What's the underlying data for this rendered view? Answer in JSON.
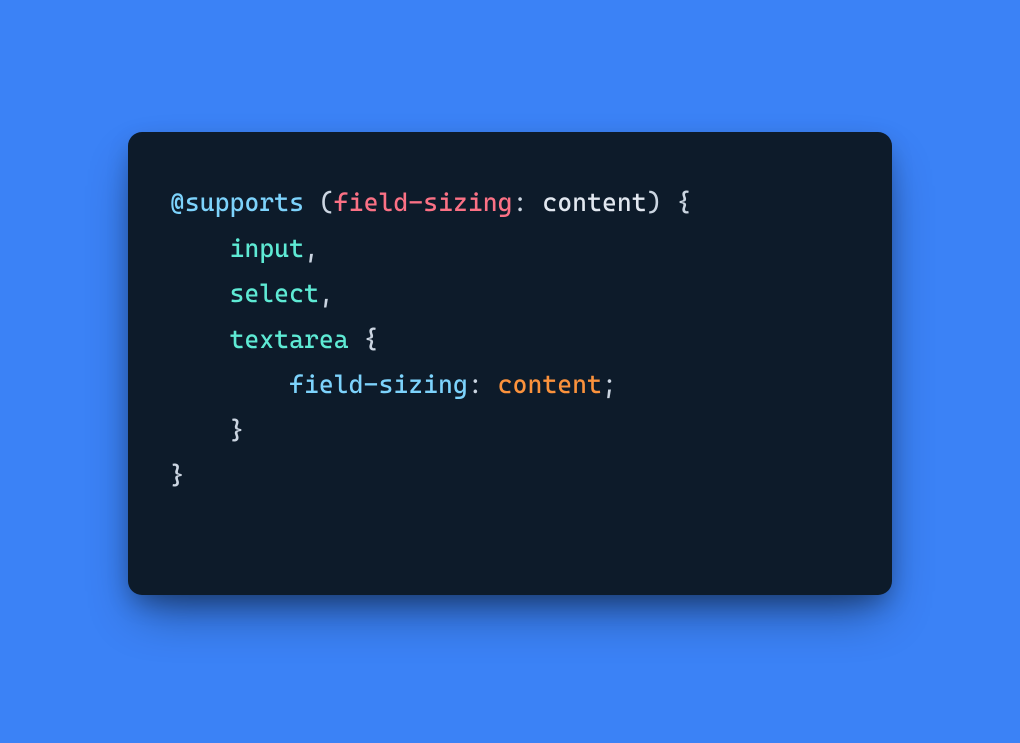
{
  "code": {
    "line1": {
      "atrule": "@supports",
      "paren_open": "(",
      "cond_prop": "field-sizing",
      "cond_colon": ":",
      "cond_space": " ",
      "cond_value": "content",
      "paren_close": ")",
      "brace_open": " {"
    },
    "line2": {
      "indent": "    ",
      "selector": "input",
      "comma": ","
    },
    "line3": {
      "indent": "    ",
      "selector": "select",
      "comma": ","
    },
    "line4": {
      "indent": "    ",
      "selector": "textarea",
      "brace_open": " {"
    },
    "line5": {
      "indent": "        ",
      "property": "field-sizing",
      "colon": ":",
      "space": " ",
      "value": "content",
      "semicolon": ";"
    },
    "line6": {
      "indent": "    ",
      "brace_close": "}"
    },
    "line7": {
      "brace_close": "}"
    }
  }
}
